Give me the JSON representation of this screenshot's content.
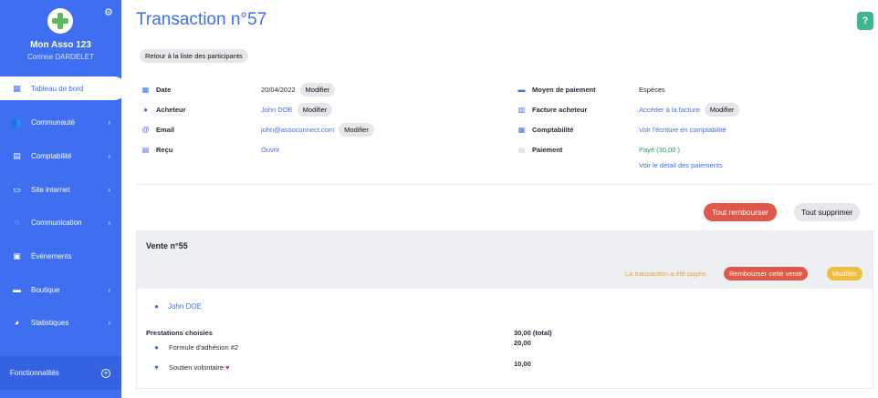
{
  "sidebar": {
    "org_name": "Mon Asso 123",
    "user_name": "Corinne DARDELET",
    "items": [
      {
        "label": "Tableau de bord",
        "icon": "dashboard-icon",
        "active": true
      },
      {
        "label": "Communauté",
        "icon": "community-icon"
      },
      {
        "label": "Comptabilité",
        "icon": "accounting-icon"
      },
      {
        "label": "Site internet",
        "icon": "website-icon"
      },
      {
        "label": "Communication",
        "icon": "communication-icon"
      },
      {
        "label": "Événements",
        "icon": "calendar-icon"
      },
      {
        "label": "Boutique",
        "icon": "shop-icon"
      },
      {
        "label": "Statistiques",
        "icon": "stats-icon"
      }
    ],
    "footer_label": "Fonctionnalités"
  },
  "header": {
    "title": "Transaction n°57",
    "help": "?",
    "back_label": "Retour à la liste des participants"
  },
  "details": {
    "date": {
      "label": "Date",
      "value": "20/04/2022",
      "action": "Modifier"
    },
    "buyer": {
      "label": "Acheteur",
      "value": "John DOE",
      "action": "Modifier"
    },
    "email": {
      "label": "Email",
      "value": "john@assoconnect.com",
      "action": "Modifier"
    },
    "receipt": {
      "label": "Reçu",
      "value": "Ouvrir"
    },
    "payment_method": {
      "label": "Moyen de paiement",
      "value": "Espèces"
    },
    "invoice": {
      "label": "Facture acheteur",
      "value": "Accéder à la facture",
      "action": "Modifier"
    },
    "accounting": {
      "label": "Comptabilité",
      "value": "Voir l'écriture en comptabilité"
    },
    "payment": {
      "label": "Paiement",
      "value": "Payé (30,00 )",
      "detail_link": "Voir le détail des paiements"
    }
  },
  "actions": {
    "refund_all": "Tout rembourser",
    "delete_all": "Tout supprimer"
  },
  "sale": {
    "title": "Vente n°55",
    "paid_text": "La transaction a été payée.",
    "refund_label": "Rembourser cette vente",
    "edit_label": "Modifier",
    "buyer": "John DOE",
    "services_title": "Prestations choisies",
    "total": "30,00  (total)",
    "items": [
      {
        "label": "Formule d'adhésion #2",
        "amount": "20,00"
      },
      {
        "label": "Soutien volontaire",
        "amount": "10,00"
      }
    ]
  },
  "colors": {
    "primary": "#3f6ef0",
    "danger": "#e0584a",
    "warning": "#f0be3c",
    "success": "#2e9c5b",
    "help": "#3fb68b"
  }
}
